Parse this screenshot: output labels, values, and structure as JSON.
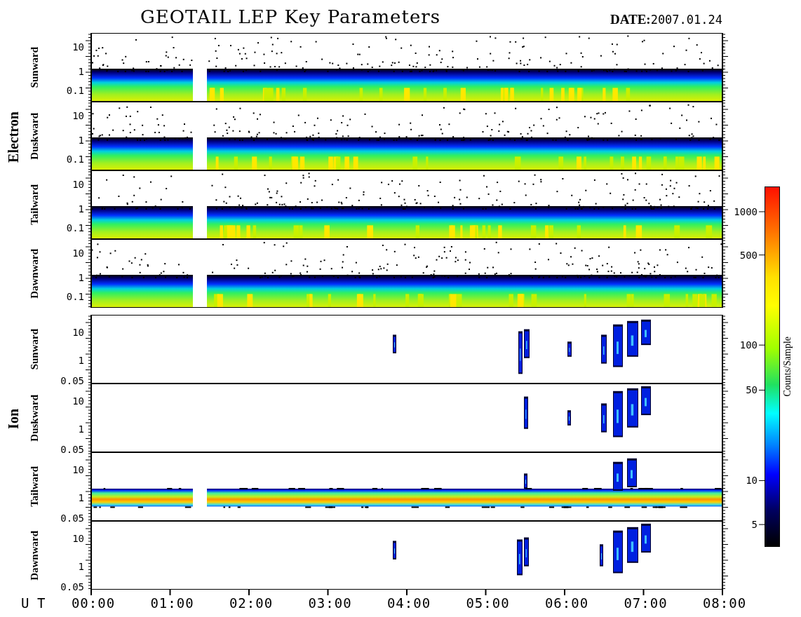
{
  "title": "GEOTAIL LEP Key Parameters",
  "date": {
    "label": "DATE:",
    "value": "2007.01.24"
  },
  "groups": [
    {
      "name": "Electron",
      "kind": "electron",
      "panels": [
        {
          "name": "Sunward",
          "kind": "full",
          "yticks": [
            "10",
            "1",
            "0.1"
          ]
        },
        {
          "name": "Duskward",
          "kind": "full",
          "yticks": [
            "10",
            "1",
            "0.1"
          ]
        },
        {
          "name": "Tailward",
          "kind": "full",
          "yticks": [
            "10",
            "1",
            "0.1"
          ]
        },
        {
          "name": "Dawnward",
          "kind": "full",
          "yticks": [
            "10",
            "1",
            "0.1"
          ]
        }
      ]
    },
    {
      "name": "Ion",
      "kind": "ion",
      "panels": [
        {
          "name": "Sunward",
          "kind": "sparse",
          "yticks": [
            "10",
            "1",
            "0.05"
          ]
        },
        {
          "name": "Duskward",
          "kind": "sparse",
          "yticks": [
            "10",
            "1",
            "0.05"
          ]
        },
        {
          "name": "Tailward",
          "kind": "band",
          "yticks": [
            "10",
            "1",
            "0.05"
          ]
        },
        {
          "name": "Dawnward",
          "kind": "sparse",
          "yticks": [
            "10",
            "1",
            "0.05"
          ]
        }
      ]
    }
  ],
  "time_axis": {
    "label": "U T",
    "ticks": [
      "00:00",
      "01:00",
      "02:00",
      "03:00",
      "04:00",
      "05:00",
      "06:00",
      "07:00",
      "08:00"
    ]
  },
  "colorbar": {
    "label": "Counts/Sample",
    "ticks": [
      "1000",
      "500",
      "100",
      "50",
      "10",
      "5"
    ]
  }
}
